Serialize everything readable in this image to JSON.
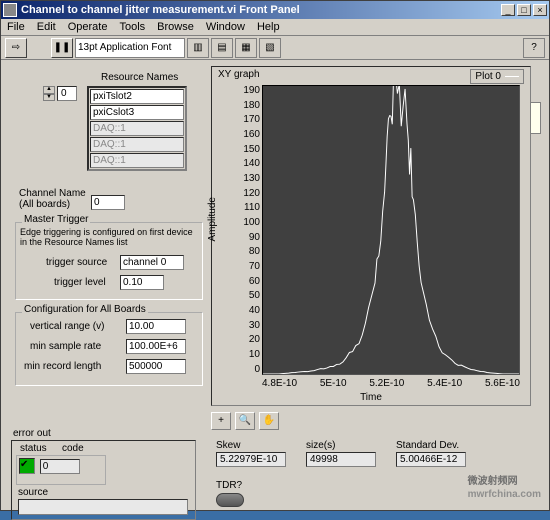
{
  "window": {
    "title": "Channel to channel jitter measurement.vi Front Panel",
    "menus": [
      "File",
      "Edit",
      "Operate",
      "Tools",
      "Browse",
      "Window",
      "Help"
    ],
    "font_box": "13pt Application Font"
  },
  "resource_names": {
    "label": "Resource Names",
    "index": "0",
    "items": [
      "pxiTslot2",
      "pxiCslot3",
      "DAQ::1",
      "DAQ::1",
      "DAQ::1"
    ]
  },
  "channel_name": {
    "label": "Channel Name (All boards)",
    "value": "0"
  },
  "master_trigger": {
    "title": "Master Trigger",
    "note": "Edge triggering is configured on first device in the Resource Names list",
    "trigger_source_label": "trigger source",
    "trigger_source_value": "channel 0",
    "trigger_level_label": "trigger level",
    "trigger_level_value": "0.10"
  },
  "config": {
    "title": "Configuration for All Boards",
    "vertical_range_label": "vertical range (v)",
    "vertical_range_value": "10.00",
    "min_sample_rate_label": "min sample rate",
    "min_sample_rate_value": "100.00E+6",
    "min_record_length_label": "min record length",
    "min_record_length_value": "500000"
  },
  "error": {
    "title": "error out",
    "status_label": "status",
    "code_label": "code",
    "code_value": "0",
    "source_label": "source",
    "source_value": ""
  },
  "graph": {
    "title": "XY graph",
    "legend": "Plot 0",
    "ylabel": "Amplitude",
    "xlabel": "Time",
    "yticks": [
      "190",
      "180",
      "170",
      "160",
      "150",
      "140",
      "130",
      "120",
      "110",
      "100",
      "90",
      "80",
      "70",
      "60",
      "50",
      "40",
      "30",
      "20",
      "10",
      "0"
    ],
    "xticks": [
      "4.8E-10",
      "5E-10",
      "5.2E-10",
      "5.4E-10",
      "5.6E-10"
    ]
  },
  "stats": {
    "skew_label": "Skew",
    "skew_value": "5.22979E-10",
    "size_label": "size(s)",
    "size_value": "49998",
    "stddev_label": "Standard Dev.",
    "stddev_value": "5.00466E-12"
  },
  "tdr": {
    "label": "TDR?"
  },
  "chart_data": {
    "type": "line",
    "title": "XY graph",
    "xlabel": "Time",
    "ylabel": "Amplitude",
    "xlim": [
      4.8e-10,
      5.6e-10
    ],
    "ylim": [
      0,
      190
    ],
    "series": [
      {
        "name": "Plot 0",
        "x": [
          4.8e-10,
          4.85e-10,
          4.9e-10,
          4.95e-10,
          5e-10,
          5.05e-10,
          5.1e-10,
          5.15e-10,
          5.18e-10,
          5.2e-10,
          5.22e-10,
          5.25e-10,
          5.27e-10,
          5.3e-10,
          5.35e-10,
          5.4e-10,
          5.45e-10,
          5.5e-10,
          5.55e-10,
          5.6e-10
        ],
        "y": [
          0,
          0,
          1,
          2,
          4,
          8,
          20,
          60,
          120,
          170,
          185,
          165,
          115,
          55,
          18,
          7,
          3,
          1,
          0,
          0
        ]
      }
    ]
  },
  "watermark": {
    "big": "微波射频网",
    "small": "mwrfchina.com"
  }
}
